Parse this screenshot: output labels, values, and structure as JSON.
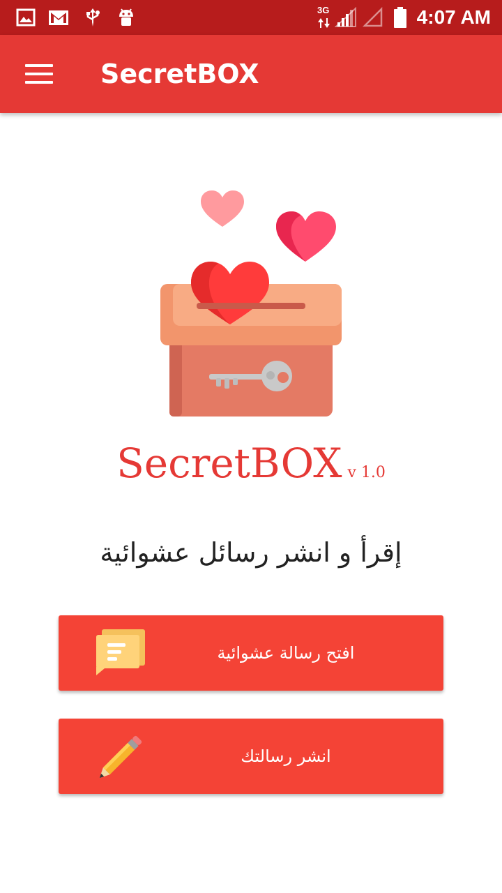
{
  "status_bar": {
    "time": "4:07 AM",
    "network": "3G",
    "icons": [
      "image-icon",
      "gmail-icon",
      "usb-icon",
      "android-icon",
      "signal-icon",
      "signal-empty-icon",
      "battery-icon"
    ]
  },
  "app_bar": {
    "title": "SecretBOX",
    "menu_icon": "hamburger-menu-icon"
  },
  "hero": {
    "illustration": "secret-box-hearts-key-icon"
  },
  "brand": {
    "name": "SecretBOX",
    "version": "v 1.0"
  },
  "tagline": "إقرأ و انشر رسائل عشوائية",
  "buttons": [
    {
      "label": "افتح رسالة عشوائية",
      "icon": "messages-icon"
    },
    {
      "label": "انشر رسالتك",
      "icon": "pencil-icon"
    }
  ],
  "colors": {
    "status_bar": "#b71c1c",
    "app_bar": "#e53935",
    "button": "#f44336",
    "brand": "#e53935"
  }
}
